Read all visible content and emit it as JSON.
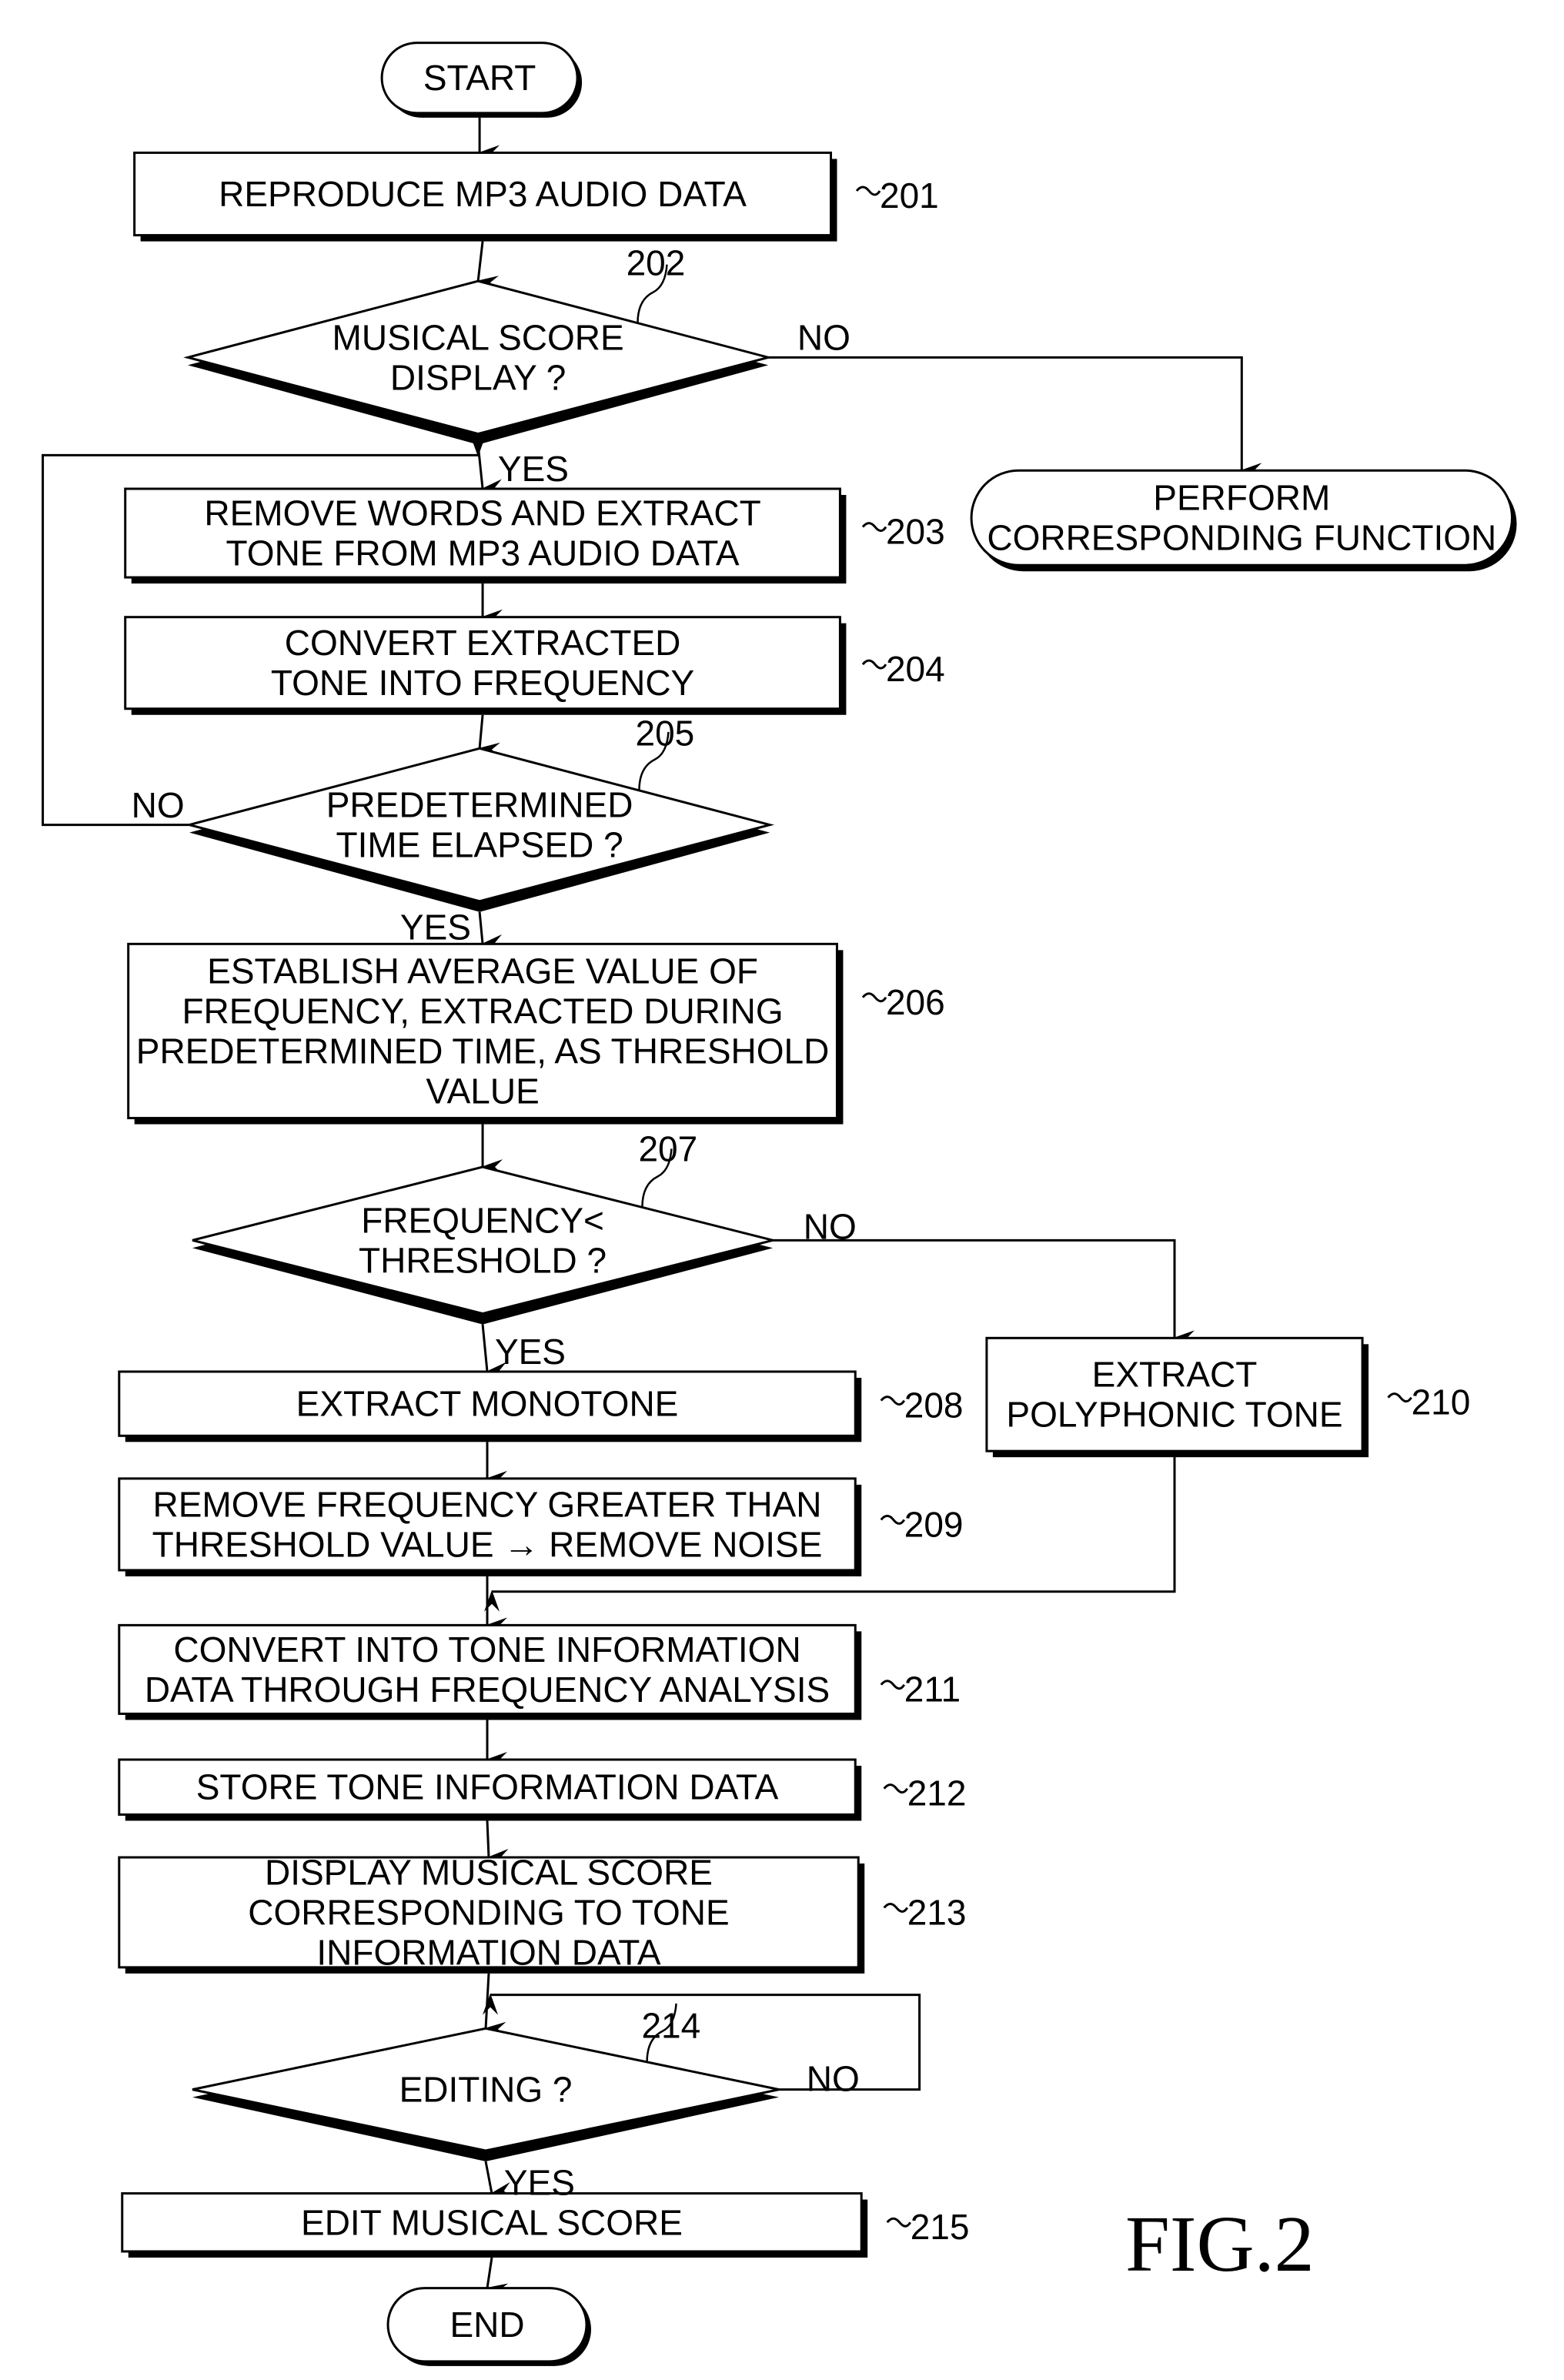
{
  "figure": {
    "title": "FIG.2",
    "start_label": "START",
    "end_label": "END"
  },
  "nodes": [
    {
      "id": "201",
      "type": "process",
      "ref": "201",
      "lines": [
        "REPRODUCE MP3  AUDIO DATA"
      ]
    },
    {
      "id": "202",
      "type": "decision",
      "ref": "202",
      "lines": [
        "MUSICAL SCORE",
        "DISPLAY ?"
      ]
    },
    {
      "id": "perform",
      "type": "terminal",
      "ref": "",
      "lines": [
        "PERFORM",
        "CORRESPONDING FUNCTION"
      ]
    },
    {
      "id": "203",
      "type": "process",
      "ref": "203",
      "lines": [
        "REMOVE WORDS AND EXTRACT",
        "TONE FROM MP3 AUDIO DATA"
      ]
    },
    {
      "id": "204",
      "type": "process",
      "ref": "204",
      "lines": [
        "CONVERT EXTRACTED",
        "TONE INTO FREQUENCY"
      ]
    },
    {
      "id": "205",
      "type": "decision",
      "ref": "205",
      "lines": [
        "PREDETERMINED",
        "TIME ELAPSED ?"
      ]
    },
    {
      "id": "206",
      "type": "process",
      "ref": "206",
      "lines": [
        "ESTABLISH AVERAGE VALUE OF",
        "FREQUENCY, EXTRACTED DURING",
        "PREDETERMINED TIME, AS THRESHOLD",
        "VALUE"
      ]
    },
    {
      "id": "207",
      "type": "decision",
      "ref": "207",
      "lines": [
        "FREQUENCY<",
        "THRESHOLD ?"
      ]
    },
    {
      "id": "208",
      "type": "process",
      "ref": "208",
      "lines": [
        "EXTRACT MONOTONE"
      ]
    },
    {
      "id": "210",
      "type": "process",
      "ref": "210",
      "lines": [
        "EXTRACT",
        "POLYPHONIC TONE"
      ]
    },
    {
      "id": "209",
      "type": "process",
      "ref": "209",
      "lines": [
        "REMOVE FREQUENCY GREATER THAN",
        "THRESHOLD VALUE → REMOVE NOISE"
      ]
    },
    {
      "id": "211",
      "type": "process",
      "ref": "211",
      "lines": [
        "CONVERT INTO TONE INFORMATION",
        "DATA THROUGH FREQUENCY ANALYSIS"
      ]
    },
    {
      "id": "212",
      "type": "process",
      "ref": "212",
      "lines": [
        "STORE TONE INFORMATION DATA"
      ]
    },
    {
      "id": "213",
      "type": "process",
      "ref": "213",
      "lines": [
        "DISPLAY MUSICAL SCORE",
        "CORRESPONDING TO TONE",
        "INFORMATION DATA"
      ]
    },
    {
      "id": "214",
      "type": "decision",
      "ref": "214",
      "lines": [
        "EDITING ?"
      ]
    },
    {
      "id": "215",
      "type": "process",
      "ref": "215",
      "lines": [
        "EDIT MUSICAL SCORE"
      ]
    }
  ],
  "edge_labels": {
    "d202_no": "NO",
    "d202_yes": "YES",
    "d205_no": "NO",
    "d205_yes": "YES",
    "d207_no": "NO",
    "d207_yes": "YES",
    "d214_no": "NO",
    "d214_yes": "YES"
  }
}
